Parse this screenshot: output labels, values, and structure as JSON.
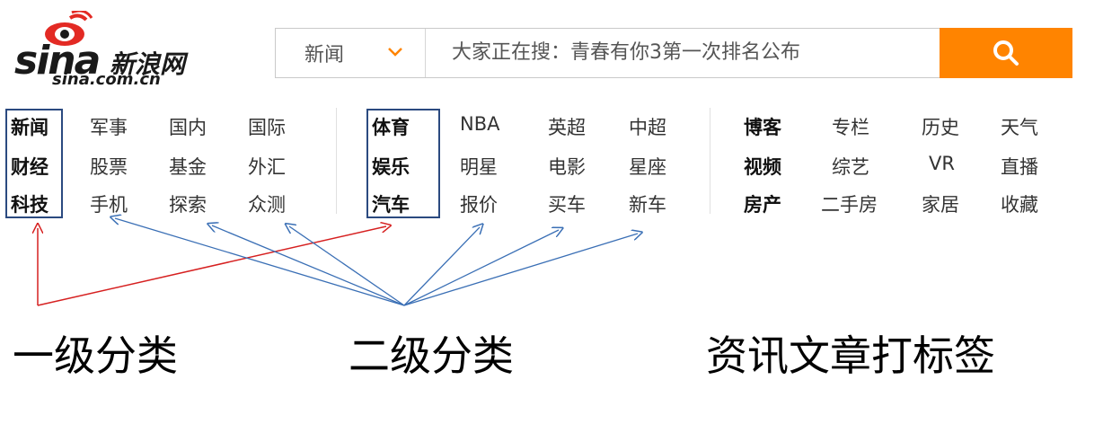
{
  "logo": {
    "wordmark": "sina",
    "cn_name": "新浪网",
    "url": "sina.com.cn"
  },
  "search": {
    "category": "新闻",
    "query": "大家正在搜：青春有你3第一次排名公布",
    "button_icon": "search-icon",
    "accent": "#ff8400"
  },
  "nav": {
    "row1": [
      "新闻",
      "军事",
      "国内",
      "国际",
      "体育",
      "NBA",
      "英超",
      "中超",
      "博客",
      "专栏",
      "历史",
      "天气"
    ],
    "row2": [
      "财经",
      "股票",
      "基金",
      "外汇",
      "娱乐",
      "明星",
      "电影",
      "星座",
      "视频",
      "综艺",
      "VR",
      "直播"
    ],
    "row3": [
      "科技",
      "手机",
      "探索",
      "众测",
      "汽车",
      "报价",
      "买车",
      "新车",
      "房产",
      "二手房",
      "家居",
      "收藏"
    ]
  },
  "captions": {
    "level1": "一级分类",
    "level2": "二级分类",
    "tagging": "资讯文章打标签"
  },
  "colors": {
    "box": "#2b4a80",
    "arrow_level1": "#d62020",
    "arrow_level2": "#3a6fb5"
  }
}
